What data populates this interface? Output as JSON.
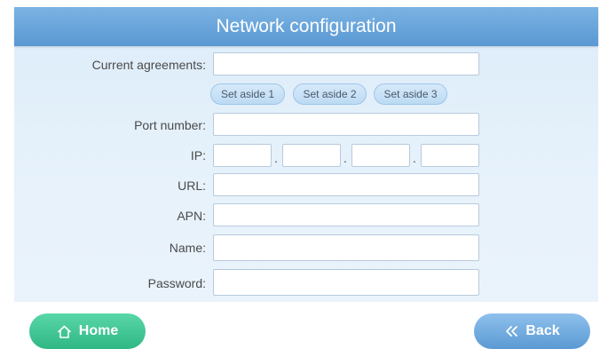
{
  "header": {
    "title": "Network configuration"
  },
  "form": {
    "current_agreements": {
      "label": "Current agreements:",
      "value": ""
    },
    "set_aside_buttons": [
      "Set aside 1",
      "Set aside 2",
      "Set aside 3"
    ],
    "port_number": {
      "label": "Port number:",
      "value": ""
    },
    "ip": {
      "label": "IP:",
      "octets": [
        "",
        "",
        "",
        ""
      ],
      "separator": "."
    },
    "url": {
      "label": "URL:",
      "value": ""
    },
    "apn": {
      "label": "APN:",
      "value": ""
    },
    "name": {
      "label": "Name:",
      "value": ""
    },
    "password": {
      "label": "Password:",
      "value": ""
    }
  },
  "footer": {
    "home_label": "Home",
    "back_label": "Back",
    "home_icon": "home-icon",
    "back_icon": "double-chevron-left-icon"
  },
  "colors": {
    "header": "#5a98d3",
    "home_button": "#2fb784",
    "back_button": "#5b9ad4",
    "panel": "#e7f2fb"
  }
}
